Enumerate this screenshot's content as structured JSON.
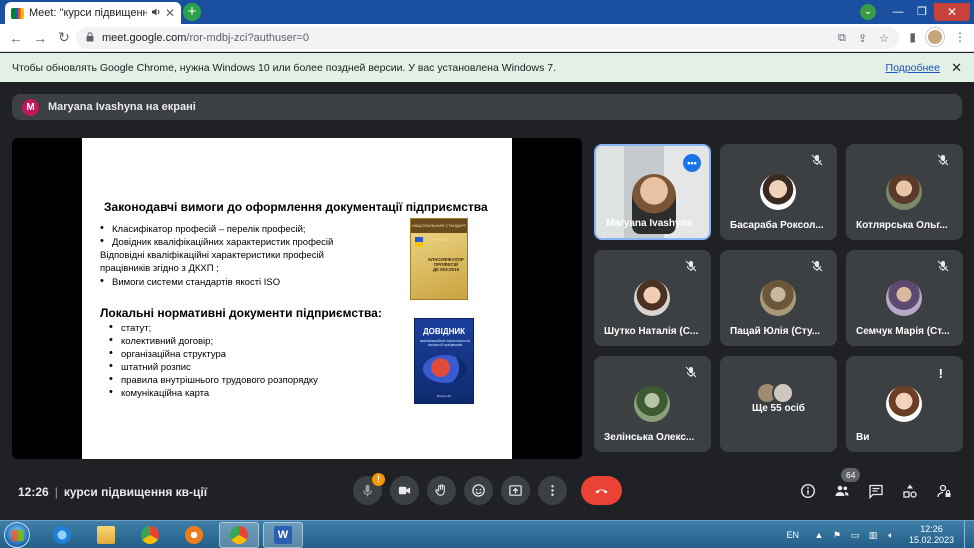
{
  "browser": {
    "tab_title": "Meet: \"курси підвищення кв",
    "tab_speaker_icon": "speaker-icon",
    "new_tab_symbol": "+",
    "url_host": "meet.google.com",
    "url_path": "/ror-mdbj-zci?authuser=0",
    "back_icon": "←",
    "forward_icon": "→",
    "reload_icon": "↻"
  },
  "infobar": {
    "message": "Чтобы обновлять Google Chrome, нужна Windows 10 или более поздней версии. У вас установлена Windows 7.",
    "link": "Подробнее",
    "close": "✕"
  },
  "presentation_bar": {
    "avatar_letter": "M",
    "text": "Maryana Ivashyna на екрані"
  },
  "slide": {
    "heading1": "Законодавчі вимоги до оформлення документації підприємства",
    "list1": [
      "Класифікатор професій – перелік професій;",
      "Довідник кваліфікаційних характеристик професій"
    ],
    "plain_line1": "Відповідні кваліфікаційні характеристики професій",
    "plain_line2": " працівників згідно з ДКХП ;",
    "list1b": "Вимоги системи стандартів якості ISO",
    "heading2": "Локальні нормативні документи підприємства:",
    "list2": [
      "статут;",
      "колективний договір;",
      "організаційна структура",
      "штатний розпис",
      "правила внутрішнього трудового розпорядку",
      "комунікаційна карта"
    ],
    "book1": {
      "top": "НАЦІОНАЛЬНИЙ СТАНДАРТ УКРАЇНИ",
      "title": "КЛАСИФІКАТОР ПРОФЕСІЙ",
      "code": "ДК 003:2010"
    },
    "book2": {
      "title": "ДОВІДНИК",
      "subtitle": "кваліфікаційних характеристик професій працівників",
      "footer": "Випуск 69"
    }
  },
  "participants": [
    {
      "name": "Maryana Ivashyna",
      "speaking": true
    },
    {
      "name": "Басараба Роксол...",
      "muted": true
    },
    {
      "name": "Котлярська Ольг...",
      "muted": true
    },
    {
      "name": "Шутко Наталія (С...",
      "muted": true
    },
    {
      "name": "Пацай Юлія (Сту...",
      "muted": true
    },
    {
      "name": "Семчук Марія (Ст...",
      "muted": true
    },
    {
      "name": "Зелінська Олекс...",
      "muted": true
    },
    {
      "name": "Ще 55 осіб"
    },
    {
      "name": "Ви",
      "alert": "!"
    }
  ],
  "meeting": {
    "time": "12:26",
    "separator": "|",
    "title": "курси підвищення кв-ції",
    "mic_warning": "!",
    "people_count": "64"
  },
  "taskbar": {
    "lang": "EN",
    "time": "12:26",
    "date": "15.02.2023",
    "tray_arrow": "▲"
  },
  "colors": {
    "meet_bg": "#202124",
    "tile_bg": "#3c4043",
    "hangup": "#ea4335",
    "speaking_border": "#8ab4f8",
    "infobar_bg": "#e2f0e6"
  }
}
